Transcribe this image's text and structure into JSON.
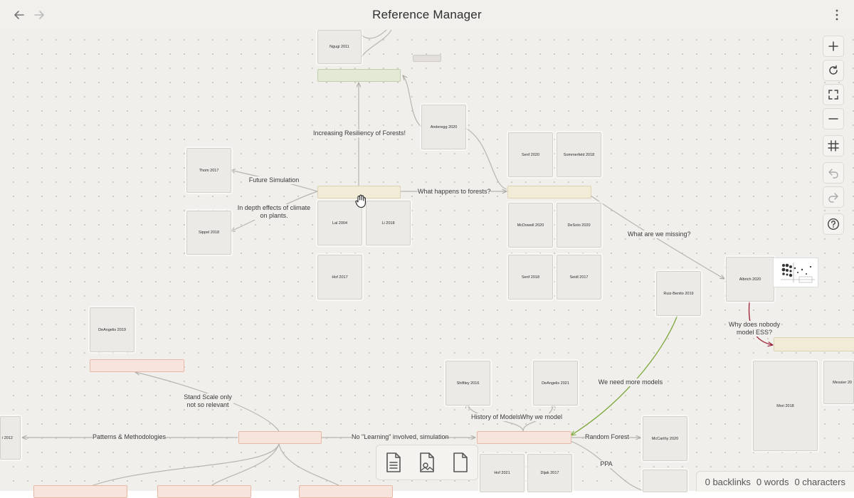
{
  "app": {
    "title": "Reference Manager"
  },
  "nav": {
    "back_icon": "arrow-left-icon",
    "forward_icon": "arrow-right-icon",
    "menu_icon": "more-vertical-icon"
  },
  "cards": [
    {
      "id": "ngugi",
      "label": "Ngugi 2011"
    },
    {
      "id": "anderegg",
      "label": "Anderegg 2020"
    },
    {
      "id": "thom",
      "label": "Thom 2017"
    },
    {
      "id": "sippel",
      "label": "Sippel 2018"
    },
    {
      "id": "lal",
      "label": "Lal 2004"
    },
    {
      "id": "li",
      "label": "Li 2018"
    },
    {
      "id": "hof2017",
      "label": "Hof 2017"
    },
    {
      "id": "senf2020",
      "label": "Senf 2020"
    },
    {
      "id": "sommerfeld",
      "label": "Sommerfeld 2018"
    },
    {
      "id": "mcdowell",
      "label": "McDowell 2020"
    },
    {
      "id": "desoto",
      "label": "DeSoto 2020"
    },
    {
      "id": "senf2018",
      "label": "Senf 2018"
    },
    {
      "id": "seidl",
      "label": "Seidl 2017"
    },
    {
      "id": "albrich",
      "label": "Albrich 2020"
    },
    {
      "id": "ruiz",
      "label": "Ruiz-Benito 2019"
    },
    {
      "id": "deangelis2019",
      "label": "DeAngelis 2019"
    },
    {
      "id": "shiftley",
      "label": "Shiftley 2016"
    },
    {
      "id": "deangelis2021",
      "label": "DeAngelis 2021"
    },
    {
      "id": "mori",
      "label": "Mori 2018"
    },
    {
      "id": "messier",
      "label": "Messier 20"
    },
    {
      "id": "mccarthy",
      "label": "McCarthy 2020"
    },
    {
      "id": "hof2021",
      "label": "Hof 2021"
    },
    {
      "id": "dijak",
      "label": "Dijak 2017"
    },
    {
      "id": "left2012",
      "label": "i 2012"
    }
  ],
  "edge_labels": {
    "increasing": "Increasing Resiliency of Forests!",
    "future": "Future Simulation",
    "indepth": "In depth effects of climate\non plants.",
    "what_happens": "What happens to forests?",
    "missing": "What are we missing?",
    "nobody": "Why does nobody\nmodel ESS?",
    "more_models": "We need more models",
    "stand_scale": "Stand Scale only\nnot so relevant",
    "patterns": "Patterns & Methodologies",
    "no_learning": "No \"Learning\" involved, simulation",
    "history": "History of Models",
    "why_model": "Why we model",
    "random_forest": "Random Forest",
    "ppa": "PPA"
  },
  "toolbar": {
    "tools": [
      "zoom-in-icon",
      "reset-view-icon",
      "fit-screen-icon",
      "zoom-out-icon",
      "grid-snap-icon",
      "undo-icon",
      "redo-icon",
      "help-icon"
    ]
  },
  "bottom_bar": {
    "items": [
      "new-note-icon",
      "new-media-icon",
      "new-file-icon"
    ]
  },
  "status": {
    "backlinks": "0 backlinks",
    "words": "0 words",
    "characters": "0 characters"
  },
  "colors": {
    "green_edge": "#7aa83a",
    "red_edge": "#9b1b30",
    "edge": "#b8b5b0"
  }
}
